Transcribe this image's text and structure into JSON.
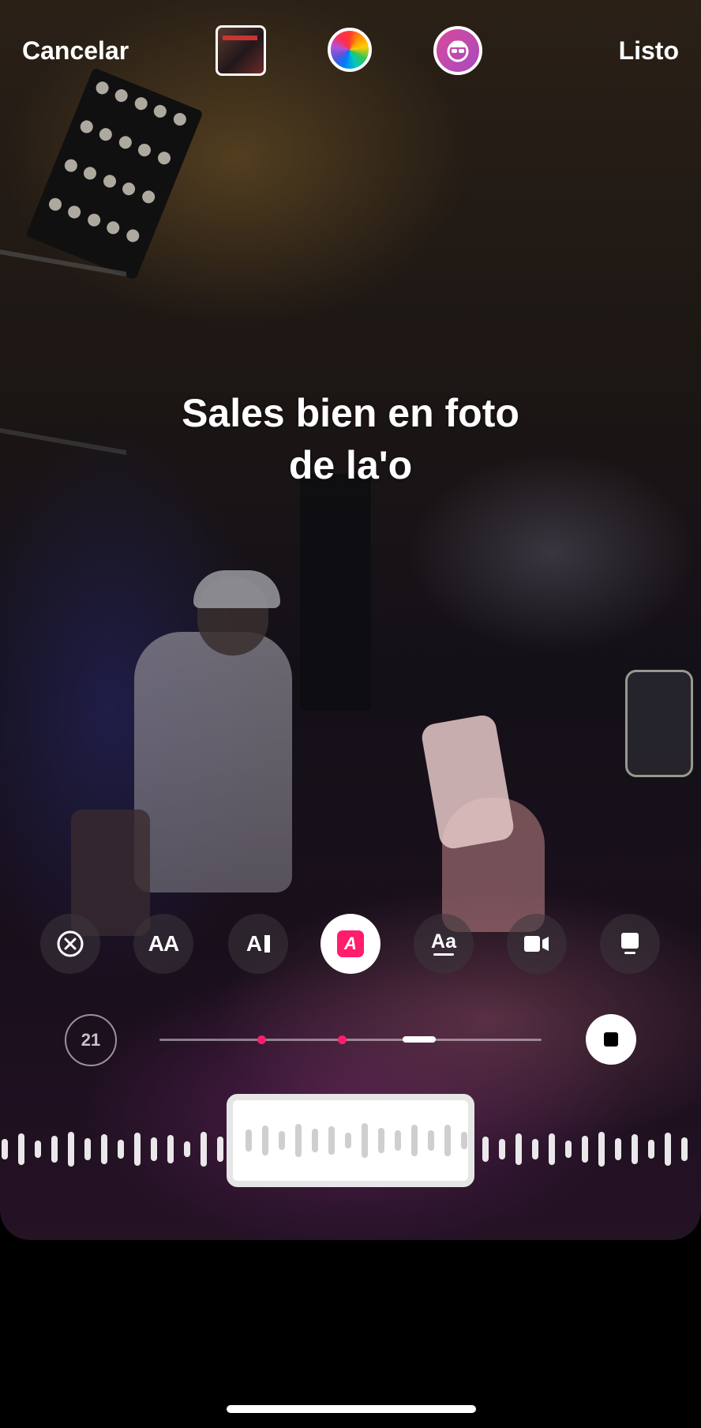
{
  "top_bar": {
    "cancel_label": "Cancelar",
    "done_label": "Listo",
    "thumbnail_icon": "album-thumbnail",
    "color_icon": "color-wheel-icon",
    "effect_icon": "face-effect-icon"
  },
  "caption": {
    "line1": "Sales bien en foto",
    "line2": "de la'o"
  },
  "tools": [
    {
      "name": "remove-text-tool",
      "icon": "close-circle-icon"
    },
    {
      "name": "font-tool",
      "label": "AA"
    },
    {
      "name": "align-tool",
      "label": "A"
    },
    {
      "name": "style-tool",
      "label": "A",
      "active": true
    },
    {
      "name": "animation-tool",
      "label": "Aa"
    },
    {
      "name": "video-tool",
      "icon": "video-icon"
    },
    {
      "name": "sticker-tool",
      "icon": "card-icon"
    }
  ],
  "timeline": {
    "counter": "21"
  },
  "colors": {
    "accent": "#ff1d6c",
    "background": "#000000"
  }
}
